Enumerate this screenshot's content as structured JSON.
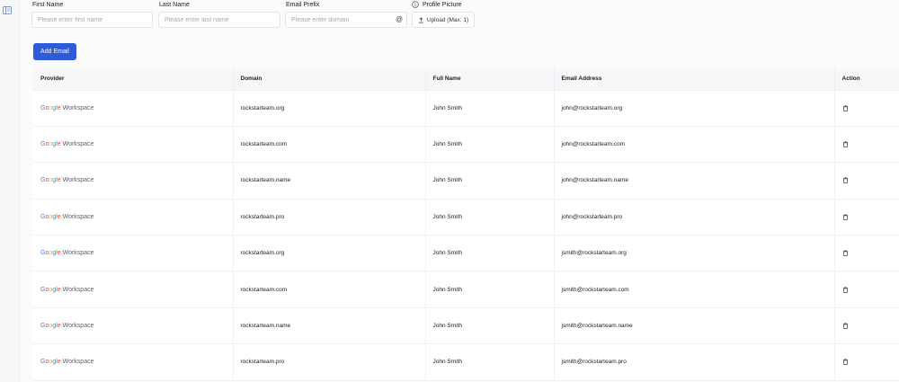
{
  "form": {
    "first_name_label": "First Name",
    "first_name_placeholder": "Please enter first name",
    "last_name_label": "Last Name",
    "last_name_placeholder": "Please enter last name",
    "email_prefix_label": "Email Prefix",
    "email_prefix_placeholder": "Please enter domain",
    "at_symbol": "@",
    "profile_picture_label": "Profile Picture",
    "upload_label": "Upload (Max: 1)"
  },
  "actions": {
    "add_email_label": "Add Email"
  },
  "table": {
    "headers": [
      "Provider",
      "Domain",
      "Full Name",
      "Email Address",
      "Action"
    ],
    "provider_suffix": "Workspace",
    "rows": [
      {
        "provider": "Google Workspace",
        "domain": "rockstarteam.org",
        "full_name": "John Smith",
        "email": "john@rockstarteam.org"
      },
      {
        "provider": "Google Workspace",
        "domain": "rockstarteam.com",
        "full_name": "John Smith",
        "email": "john@rockstarteam.com"
      },
      {
        "provider": "Google Workspace",
        "domain": "rockstarteam.name",
        "full_name": "John Smith",
        "email": "john@rockstarteam.name"
      },
      {
        "provider": "Google Workspace",
        "domain": "rockstarteam.pro",
        "full_name": "John Smith",
        "email": "john@rockstarteam.pro"
      },
      {
        "provider": "Google Workspace",
        "domain": "rockstarteam.org",
        "full_name": "John Smith",
        "email": "jsmith@rockstarteam.org"
      },
      {
        "provider": "Google Workspace",
        "domain": "rockstarteam.com",
        "full_name": "John Smith",
        "email": "jsmith@rockstarteam.com"
      },
      {
        "provider": "Google Workspace",
        "domain": "rockstarteam.name",
        "full_name": "John Smith",
        "email": "jsmith@rockstarteam.name"
      },
      {
        "provider": "Google Workspace",
        "domain": "rockstarteam.pro",
        "full_name": "John Smith",
        "email": "jsmith@rockstarteam.pro"
      }
    ]
  },
  "icons": {
    "rail": "sidebar-toggle-icon",
    "info": "info-icon",
    "upload": "upload-icon",
    "delete": "trash-icon"
  },
  "colors": {
    "primary": "#2f5bd9",
    "google_blue": "#4285f4",
    "google_red": "#ea4335",
    "google_yellow": "#fbbc05",
    "google_green": "#34a853"
  }
}
